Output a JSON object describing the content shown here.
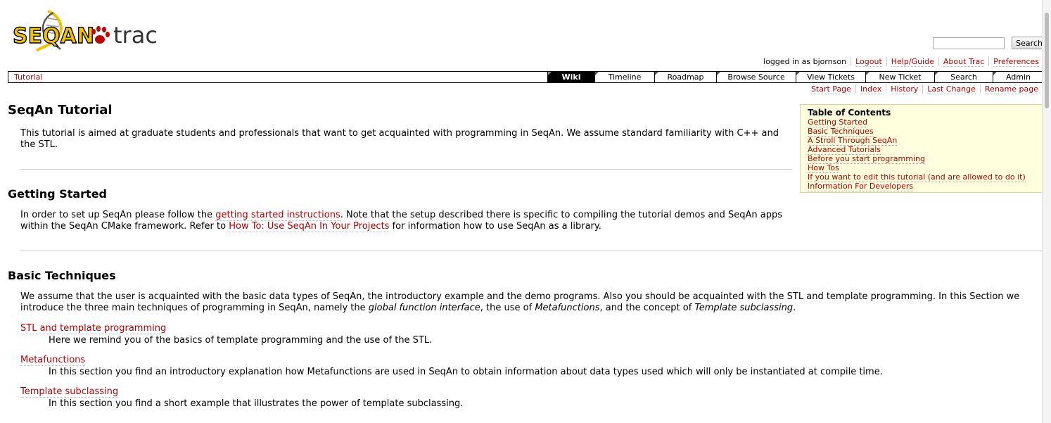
{
  "logo": {
    "text_a": "SEQAN",
    "text_b": "trac"
  },
  "search": {
    "placeholder": "",
    "button_label": "Search"
  },
  "metanav": {
    "logged_in": "logged in as bjornson",
    "items": [
      "Logout",
      "Help/Guide",
      "About Trac",
      "Preferences"
    ]
  },
  "breadcrumb": "Tutorial",
  "mainnav": {
    "tabs": [
      "Wiki",
      "Timeline",
      "Roadmap",
      "Browse Source",
      "View Tickets",
      "New Ticket",
      "Search",
      "Admin"
    ],
    "active": "Wiki"
  },
  "ctxtnav": [
    "Start Page",
    "Index",
    "History",
    "Last Change",
    "Rename page"
  ],
  "page": {
    "title": "SeqAn Tutorial",
    "intro": "This tutorial is aimed at graduate students and professionals that want to get acquainted with programming in SeqAn. We assume standard familiarity with C++ and the STL.",
    "getting_started": {
      "heading": "Getting Started",
      "p1": "In order to set up SeqAn please follow the ",
      "link1": "getting started instructions",
      "p2": ". Note that the setup described there is specific to compiling the tutorial demos and SeqAn apps within the SeqAn CMake framework. Refer to ",
      "link2": "How To: Use SeqAn In Your Projects",
      "p3": " for information how to use SeqAn as a library."
    },
    "basic_techniques": {
      "heading": "Basic Techniques",
      "p1": "We assume that the user is acquainted with the basic data types of SeqAn, the introductory example and the demo programs. Also you should be acquainted with the STL and template programming. In this Section we introduce the three main techniques of programming in SeqAn, namely the ",
      "em1": "global function interface",
      "p2": ", the use of ",
      "em2": "Metafunctions",
      "p3": ", and the concept of ",
      "em3": "Template subclassing",
      "p4": ".",
      "items": [
        {
          "term": "STL and template programming",
          "desc": "Here we remind you of the basics of template programming and the use of the STL."
        },
        {
          "term": "Metafunctions",
          "desc": "In this section you find an introductory explanation how Metafunctions are used in SeqAn to obtain information about data types used which will only be instantiated at compile time."
        },
        {
          "term": "Template subclassing",
          "desc": "In this section you find a short example that illustrates the power of template subclassing."
        }
      ]
    }
  },
  "toc": {
    "title": "Table of Contents",
    "items": [
      "Getting Started",
      "Basic Techniques",
      "A Stroll Through SeqAn",
      "Advanced Tutorials",
      "Before you start programming",
      "How Tos",
      "If you want to edit this tutorial (and are allowed to do it)",
      "Information For Developers"
    ]
  }
}
